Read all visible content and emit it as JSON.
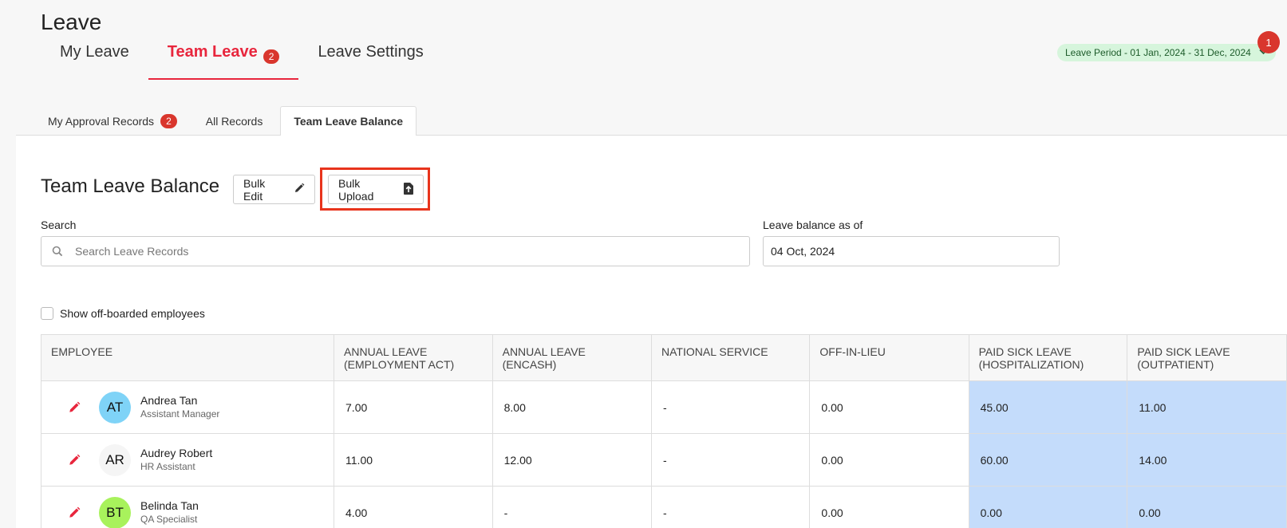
{
  "header": {
    "title": "Leave",
    "tabs": [
      {
        "label": "My Leave",
        "badge": ""
      },
      {
        "label": "Team Leave",
        "badge": "2"
      },
      {
        "label": "Leave Settings",
        "badge": ""
      }
    ],
    "period_label": "Leave Period - 01 Jan, 2024 - 31 Dec, 2024",
    "period_badge": "1"
  },
  "subtabs": [
    {
      "label": "My Approval Records",
      "badge": "2"
    },
    {
      "label": "All Records"
    },
    {
      "label": "Team Leave Balance"
    }
  ],
  "section": {
    "title": "Team Leave Balance",
    "bulk_edit_label": "Bulk Edit",
    "bulk_upload_label": "Bulk Upload"
  },
  "filters": {
    "search_label": "Search",
    "search_placeholder": "Search Leave Records",
    "balance_label": "Leave balance as of",
    "balance_date": "04 Oct, 2024",
    "offboarded_label": "Show off-boarded employees"
  },
  "table": {
    "columns": [
      {
        "line1": "EMPLOYEE",
        "line2": ""
      },
      {
        "line1": "ANNUAL LEAVE",
        "line2": "(EMPLOYMENT ACT)"
      },
      {
        "line1": "ANNUAL LEAVE",
        "line2": "(ENCASH)"
      },
      {
        "line1": "NATIONAL SERVICE",
        "line2": ""
      },
      {
        "line1": "OFF-IN-LIEU",
        "line2": ""
      },
      {
        "line1": "PAID SICK LEAVE",
        "line2": "(HOSPITALIZATION)"
      },
      {
        "line1": "PAID SICK LEAVE",
        "line2": "(OUTPATIENT)"
      }
    ],
    "rows": [
      {
        "initials": "AT",
        "avatar_color": "#7fd3f7",
        "name": "Andrea Tan",
        "role": "Assistant Manager",
        "values": [
          "7.00",
          "8.00",
          "-",
          "0.00",
          "45.00",
          "11.00"
        ]
      },
      {
        "initials": "AR",
        "avatar_color": "#f5f5f5",
        "name": "Audrey Robert",
        "role": "HR Assistant",
        "values": [
          "11.00",
          "12.00",
          "-",
          "0.00",
          "60.00",
          "14.00"
        ]
      },
      {
        "initials": "BT",
        "avatar_color": "#a8f25c",
        "name": "Belinda Tan",
        "role": "QA Specialist",
        "values": [
          "4.00",
          "-",
          "-",
          "0.00",
          "0.00",
          "0.00"
        ]
      }
    ]
  },
  "colors": {
    "accent": "#e8263d",
    "badge": "#d9362d",
    "sick_highlight": "#c4dcfb",
    "period_bg": "#d6f5dc"
  }
}
